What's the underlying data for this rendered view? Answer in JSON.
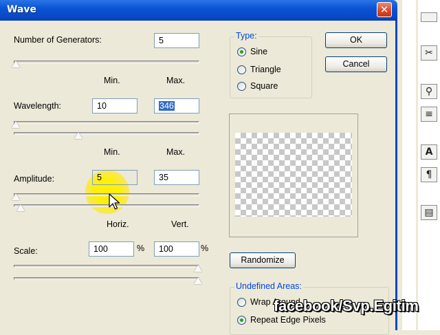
{
  "window": {
    "title": "Wave",
    "close_symbol": "✕"
  },
  "generators": {
    "label": "Number of Generators:",
    "value": "5"
  },
  "range_headers": {
    "min": "Min.",
    "max": "Max."
  },
  "wavelength": {
    "label": "Wavelength:",
    "min": "10",
    "max": "346"
  },
  "amplitude": {
    "label": "Amplitude:",
    "min": "5",
    "max": "35"
  },
  "scale": {
    "label": "Scale:",
    "horiz_header": "Horiz.",
    "vert_header": "Vert.",
    "horiz": "100",
    "vert": "100",
    "unit": "%"
  },
  "type_group": {
    "legend": "Type:",
    "options": [
      "Sine",
      "Triangle",
      "Square"
    ],
    "selected": "Sine"
  },
  "buttons": {
    "ok": "OK",
    "cancel": "Cancel",
    "randomize": "Randomize"
  },
  "undefined_areas": {
    "legend": "Undefined Areas:",
    "options": [
      "Wrap Around",
      "Repeat Edge Pixels"
    ],
    "selected": "Repeat Edge Pixels"
  },
  "watermark": "facebook/Svp.Egitim",
  "toolbar_icons": [
    "scissors-icon",
    "stamp-icon",
    "layers-icon",
    "text-a-icon",
    "paragraph-icon",
    "panel-icon"
  ]
}
